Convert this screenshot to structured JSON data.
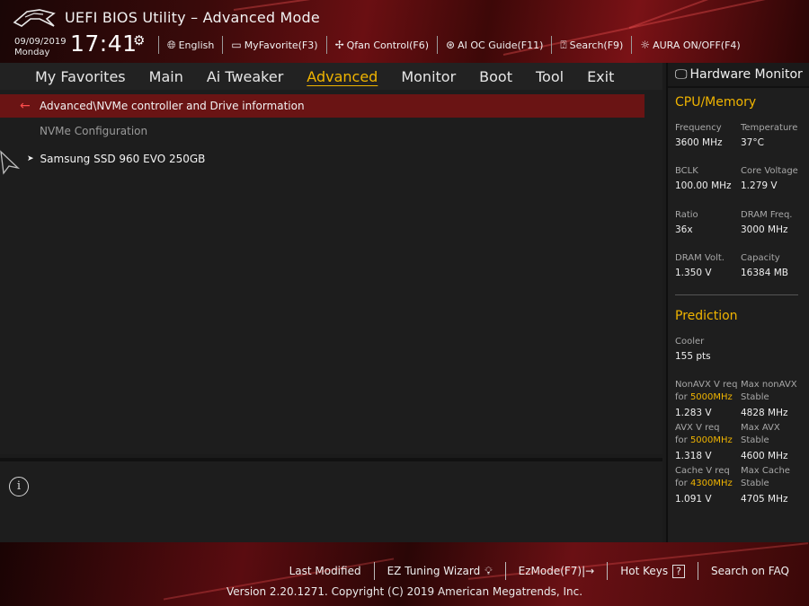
{
  "header": {
    "title": "UEFI BIOS Utility – Advanced Mode",
    "date": "09/09/2019",
    "day": "Monday",
    "time": "17:41",
    "tools": [
      {
        "label": "English",
        "icon": "globe-icon"
      },
      {
        "label": "MyFavorite(F3)",
        "icon": "favorite-icon"
      },
      {
        "label": "Qfan Control(F6)",
        "icon": "fan-icon"
      },
      {
        "label": "AI OC Guide(F11)",
        "icon": "ai-chip-icon"
      },
      {
        "label": "Search(F9)",
        "icon": "help-search-icon"
      },
      {
        "label": "AURA ON/OFF(F4)",
        "icon": "aura-light-icon"
      }
    ]
  },
  "nav": {
    "tabs": [
      "My Favorites",
      "Main",
      "Ai Tweaker",
      "Advanced",
      "Monitor",
      "Boot",
      "Tool",
      "Exit"
    ],
    "active": "Advanced"
  },
  "main": {
    "breadcrumb": "Advanced\\NVMe controller and Drive information",
    "config_label": "NVMe Configuration",
    "items": [
      "Samsung SSD 960 EVO 250GB"
    ]
  },
  "hwm": {
    "title": "Hardware Monitor",
    "cpu_section": "CPU/Memory",
    "frequency_label": "Frequency",
    "frequency_value": "3600 MHz",
    "temperature_label": "Temperature",
    "temperature_value": "37°C",
    "bclk_label": "BCLK",
    "bclk_value": "100.00 MHz",
    "core_voltage_label": "Core Voltage",
    "core_voltage_value": "1.279 V",
    "ratio_label": "Ratio",
    "ratio_value": "36x",
    "dram_freq_label": "DRAM Freq.",
    "dram_freq_value": "3000 MHz",
    "dram_volt_label": "DRAM Volt.",
    "dram_volt_value": "1.350 V",
    "capacity_label": "Capacity",
    "capacity_value": "16384 MB",
    "prediction_section": "Prediction",
    "cooler_label": "Cooler",
    "cooler_value": "155 pts",
    "nonavx_req_label": "NonAVX V req",
    "nonavx_for": "for",
    "nonavx_freq": "5000MHz",
    "nonavx_req_value": "1.283 V",
    "max_nonavx_label": "Max nonAVX",
    "max_nonavx_stable": "Stable",
    "max_nonavx_value": "4828 MHz",
    "avx_req_label": "AVX V req",
    "avx_for": "for",
    "avx_freq": "5000MHz",
    "avx_req_value": "1.318 V",
    "max_avx_label": "Max AVX",
    "max_avx_stable": "Stable",
    "max_avx_value": "4600 MHz",
    "cache_req_label": "Cache V req",
    "cache_for": "for",
    "cache_freq": "4300MHz",
    "cache_req_value": "1.091 V",
    "max_cache_label": "Max Cache",
    "max_cache_stable": "Stable",
    "max_cache_value": "4705 MHz"
  },
  "footer": {
    "links": [
      "Last Modified",
      "EZ Tuning Wizard",
      "EzMode(F7)|→",
      "Hot Keys",
      "Search on FAQ"
    ],
    "hotkeys_icon_text": "?",
    "version": "Version 2.20.1271. Copyright (C) 2019 American Megatrends, Inc."
  },
  "colors": {
    "accent": "#f0b400",
    "breadcrumb_bg": "#6a1414",
    "back_arrow": "#ff4d4d"
  }
}
